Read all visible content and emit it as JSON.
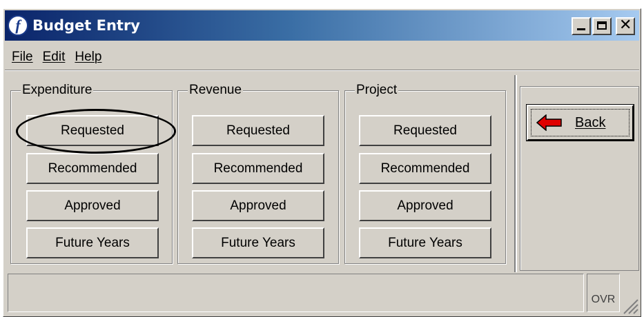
{
  "window": {
    "title": "Budget Entry",
    "app_icon": "f-logo-icon",
    "controls": [
      "minimize",
      "maximize",
      "close"
    ]
  },
  "menu": {
    "items": [
      "File",
      "Edit",
      "Help"
    ]
  },
  "groups": [
    {
      "label": "Expenditure",
      "buttons": [
        "Requested",
        "Recommended",
        "Approved",
        "Future Years"
      ]
    },
    {
      "label": "Revenue",
      "buttons": [
        "Requested",
        "Recommended",
        "Approved",
        "Future Years"
      ]
    },
    {
      "label": "Project",
      "buttons": [
        "Requested",
        "Recommended",
        "Approved",
        "Future Years"
      ]
    }
  ],
  "nav": {
    "back_label": "Back",
    "back_icon": "red-left-arrow-icon"
  },
  "status": {
    "message": "",
    "ovr_label": "OVR"
  },
  "colors": {
    "titlebar_start": "#0a246a",
    "titlebar_end": "#a6caf0",
    "face": "#d4d0c8",
    "arrow": "#e00000"
  }
}
